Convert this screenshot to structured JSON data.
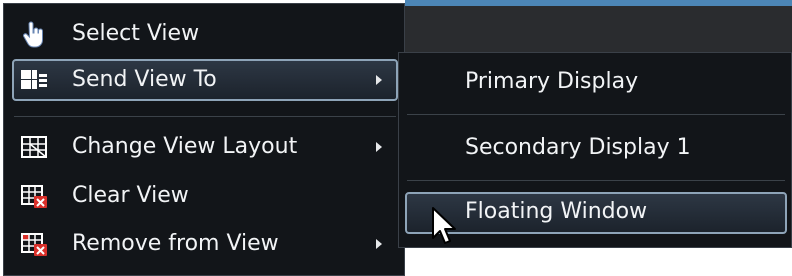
{
  "context_menu": {
    "items": [
      {
        "label": "Select View",
        "icon": "hand-pointer-icon",
        "has_submenu": false
      },
      {
        "label": "Send View To",
        "icon": "send-view-icon",
        "has_submenu": true,
        "highlighted": true
      },
      {
        "label": "Change View Layout",
        "icon": "grid-layout-icon",
        "has_submenu": true
      },
      {
        "label": "Clear View",
        "icon": "clear-view-icon",
        "has_submenu": false
      },
      {
        "label": "Remove from View",
        "icon": "remove-from-view-icon",
        "has_submenu": true
      }
    ]
  },
  "submenu": {
    "items": [
      {
        "label": "Primary Display"
      },
      {
        "label": "Secondary Display 1"
      },
      {
        "label": "Floating Window",
        "highlighted": true
      }
    ]
  },
  "colors": {
    "menu_bg": "#121519",
    "highlight_border": "#8ea4b8",
    "text": "#f2f4f6",
    "accent_top": "#4c86b6",
    "delete_red": "#d9302a"
  }
}
